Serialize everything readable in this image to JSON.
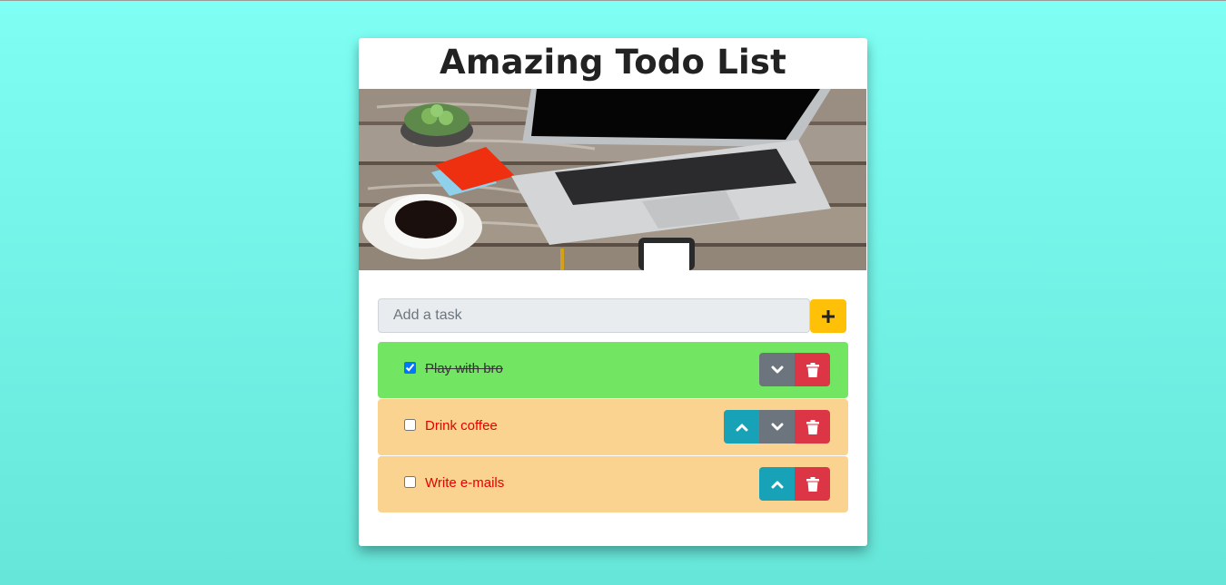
{
  "app": {
    "title": "Amazing Todo List",
    "hero_image": "laptop-coffee-desk-photo"
  },
  "add_task": {
    "placeholder": "Add a task",
    "value": "",
    "button_icon": "plus-icon"
  },
  "tasks": [
    {
      "label": "Play with bro",
      "checked": true,
      "status": "done"
    },
    {
      "label": "Drink coffee",
      "checked": false,
      "status": "pending"
    },
    {
      "label": "Write e-mails",
      "checked": false,
      "status": "pending"
    }
  ],
  "colors": {
    "background_top": "#7ffff4",
    "background_bottom": "#66e6d8",
    "done_item": "#72e663",
    "pending_item": "#f9d38f",
    "pending_text": "#e60000",
    "add_button": "#ffc107",
    "up_button": "#17a2b8",
    "down_button": "#6c757d",
    "delete_button": "#dc3545"
  },
  "icons": {
    "move_up": "chevron-up-icon",
    "move_down": "chevron-down-icon",
    "delete": "trash-icon"
  }
}
